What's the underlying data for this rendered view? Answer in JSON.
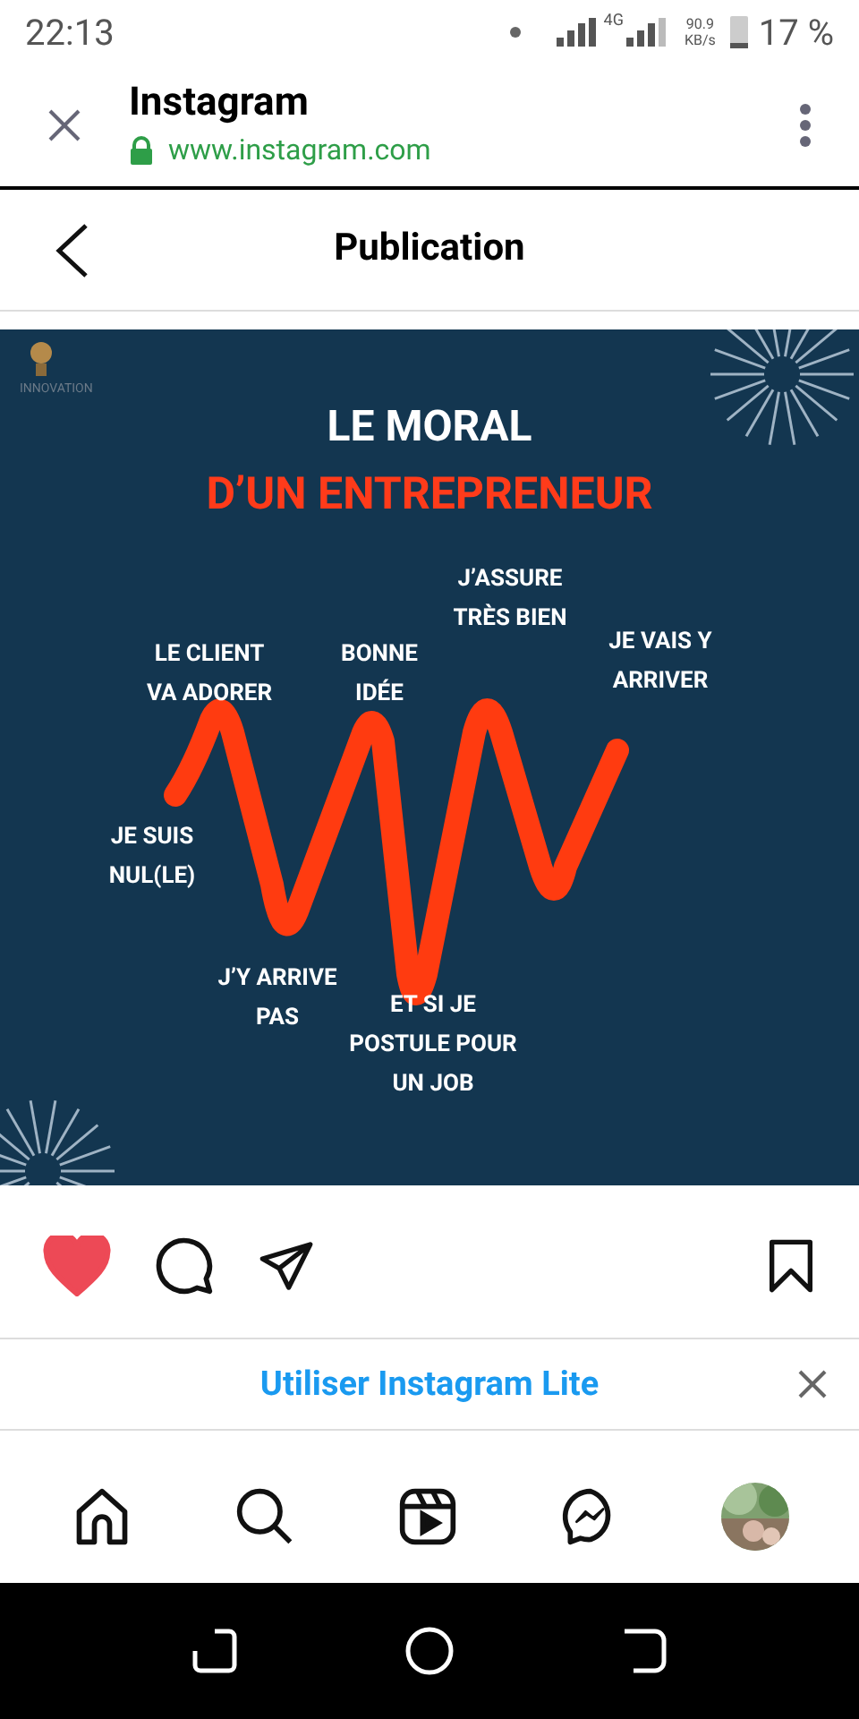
{
  "status_bar": {
    "time": "22:13",
    "network": "4G",
    "speed": "90.9",
    "speed_unit": "KB/s",
    "battery": "17 %"
  },
  "browser": {
    "title": "Instagram",
    "url": "www.instagram.com"
  },
  "header": {
    "title": "Publication"
  },
  "post": {
    "logo": "INNOVATION",
    "title": "LE MORAL",
    "subtitle": "D’UN ENTREPRENEUR",
    "labels": [
      "J’ASSURE\nTRÈS BIEN",
      "LE CLIENT\nVA ADORER",
      "BONNE\nIDÉE",
      "JE VAIS Y\nARRIVER",
      "JE SUIS\nNUL(LE)",
      "J’Y ARRIVE\nPAS",
      "ET SI JE\nPOSTULE POUR\nUN JOB"
    ]
  },
  "actions": {
    "liked": true,
    "saved": false
  },
  "banner": {
    "text": "Utiliser Instagram Lite"
  }
}
